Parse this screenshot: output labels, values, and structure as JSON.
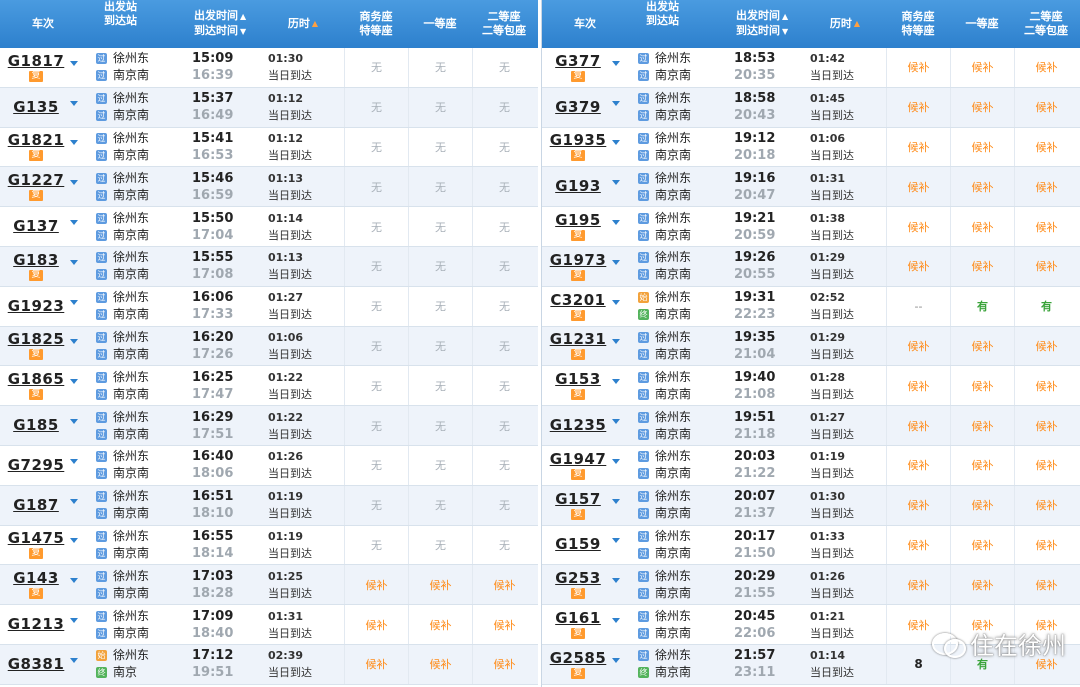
{
  "header": {
    "train": "车次",
    "dep_station": "出发站",
    "arr_station": "到达站",
    "dep_time": "出发时间",
    "arr_time": "到达时间",
    "duration": "历时",
    "business_1": "商务座",
    "business_2": "特等座",
    "first": "一等座",
    "second_1": "二等座",
    "second_2": "二等包座",
    "arrow_up": "▲",
    "arrow_down": "▼"
  },
  "badge_fu": "复",
  "watermark": "住在徐州",
  "left_rows": [
    {
      "train": "G1817",
      "fu": true,
      "from": "徐州东",
      "to": "南京南",
      "from_icon": "guo",
      "to_icon": "guo",
      "dep": "15:09",
      "arr": "16:39",
      "dur": "01:30",
      "day": "当日到达",
      "s1": "无",
      "s2": "无",
      "s3": "无"
    },
    {
      "train": "G135",
      "fu": false,
      "from": "徐州东",
      "to": "南京南",
      "from_icon": "guo",
      "to_icon": "guo",
      "dep": "15:37",
      "arr": "16:49",
      "dur": "01:12",
      "day": "当日到达",
      "s1": "无",
      "s2": "无",
      "s3": "无"
    },
    {
      "train": "G1821",
      "fu": true,
      "from": "徐州东",
      "to": "南京南",
      "from_icon": "guo",
      "to_icon": "guo",
      "dep": "15:41",
      "arr": "16:53",
      "dur": "01:12",
      "day": "当日到达",
      "s1": "无",
      "s2": "无",
      "s3": "无"
    },
    {
      "train": "G1227",
      "fu": true,
      "from": "徐州东",
      "to": "南京南",
      "from_icon": "guo",
      "to_icon": "guo",
      "dep": "15:46",
      "arr": "16:59",
      "dur": "01:13",
      "day": "当日到达",
      "s1": "无",
      "s2": "无",
      "s3": "无"
    },
    {
      "train": "G137",
      "fu": false,
      "from": "徐州东",
      "to": "南京南",
      "from_icon": "guo",
      "to_icon": "guo",
      "dep": "15:50",
      "arr": "17:04",
      "dur": "01:14",
      "day": "当日到达",
      "s1": "无",
      "s2": "无",
      "s3": "无"
    },
    {
      "train": "G183",
      "fu": true,
      "from": "徐州东",
      "to": "南京南",
      "from_icon": "guo",
      "to_icon": "guo",
      "dep": "15:55",
      "arr": "17:08",
      "dur": "01:13",
      "day": "当日到达",
      "s1": "无",
      "s2": "无",
      "s3": "无"
    },
    {
      "train": "G1923",
      "fu": false,
      "from": "徐州东",
      "to": "南京南",
      "from_icon": "guo",
      "to_icon": "guo",
      "dep": "16:06",
      "arr": "17:33",
      "dur": "01:27",
      "day": "当日到达",
      "s1": "无",
      "s2": "无",
      "s3": "无"
    },
    {
      "train": "G1825",
      "fu": true,
      "from": "徐州东",
      "to": "南京南",
      "from_icon": "guo",
      "to_icon": "guo",
      "dep": "16:20",
      "arr": "17:26",
      "dur": "01:06",
      "day": "当日到达",
      "s1": "无",
      "s2": "无",
      "s3": "无"
    },
    {
      "train": "G1865",
      "fu": true,
      "from": "徐州东",
      "to": "南京南",
      "from_icon": "guo",
      "to_icon": "guo",
      "dep": "16:25",
      "arr": "17:47",
      "dur": "01:22",
      "day": "当日到达",
      "s1": "无",
      "s2": "无",
      "s3": "无"
    },
    {
      "train": "G185",
      "fu": false,
      "from": "徐州东",
      "to": "南京南",
      "from_icon": "guo",
      "to_icon": "guo",
      "dep": "16:29",
      "arr": "17:51",
      "dur": "01:22",
      "day": "当日到达",
      "s1": "无",
      "s2": "无",
      "s3": "无"
    },
    {
      "train": "G7295",
      "fu": false,
      "from": "徐州东",
      "to": "南京南",
      "from_icon": "guo",
      "to_icon": "guo",
      "dep": "16:40",
      "arr": "18:06",
      "dur": "01:26",
      "day": "当日到达",
      "s1": "无",
      "s2": "无",
      "s3": "无"
    },
    {
      "train": "G187",
      "fu": false,
      "from": "徐州东",
      "to": "南京南",
      "from_icon": "guo",
      "to_icon": "guo",
      "dep": "16:51",
      "arr": "18:10",
      "dur": "01:19",
      "day": "当日到达",
      "s1": "无",
      "s2": "无",
      "s3": "无"
    },
    {
      "train": "G1475",
      "fu": true,
      "from": "徐州东",
      "to": "南京南",
      "from_icon": "guo",
      "to_icon": "guo",
      "dep": "16:55",
      "arr": "18:14",
      "dur": "01:19",
      "day": "当日到达",
      "s1": "无",
      "s2": "无",
      "s3": "无"
    },
    {
      "train": "G143",
      "fu": true,
      "from": "徐州东",
      "to": "南京南",
      "from_icon": "guo",
      "to_icon": "guo",
      "dep": "17:03",
      "arr": "18:28",
      "dur": "01:25",
      "day": "当日到达",
      "s1": "候补",
      "s2": "候补",
      "s3": "候补"
    },
    {
      "train": "G1213",
      "fu": false,
      "from": "徐州东",
      "to": "南京南",
      "from_icon": "guo",
      "to_icon": "guo",
      "dep": "17:09",
      "arr": "18:40",
      "dur": "01:31",
      "day": "当日到达",
      "s1": "候补",
      "s2": "候补",
      "s3": "候补"
    },
    {
      "train": "G8381",
      "fu": false,
      "from": "徐州东",
      "to": "南京",
      "from_icon": "shi",
      "to_icon": "zhong",
      "dep": "17:12",
      "arr": "19:51",
      "dur": "02:39",
      "day": "当日到达",
      "s1": "候补",
      "s2": "候补",
      "s3": "候补"
    }
  ],
  "right_rows": [
    {
      "train": "G377",
      "fu": true,
      "from": "徐州东",
      "to": "南京南",
      "from_icon": "guo",
      "to_icon": "guo",
      "dep": "18:53",
      "arr": "20:35",
      "dur": "01:42",
      "day": "当日到达",
      "s1": "候补",
      "s2": "候补",
      "s3": "候补"
    },
    {
      "train": "G379",
      "fu": false,
      "from": "徐州东",
      "to": "南京南",
      "from_icon": "guo",
      "to_icon": "guo",
      "dep": "18:58",
      "arr": "20:43",
      "dur": "01:45",
      "day": "当日到达",
      "s1": "候补",
      "s2": "候补",
      "s3": "候补"
    },
    {
      "train": "G1935",
      "fu": true,
      "from": "徐州东",
      "to": "南京南",
      "from_icon": "guo",
      "to_icon": "guo",
      "dep": "19:12",
      "arr": "20:18",
      "dur": "01:06",
      "day": "当日到达",
      "s1": "候补",
      "s2": "候补",
      "s3": "候补"
    },
    {
      "train": "G193",
      "fu": false,
      "from": "徐州东",
      "to": "南京南",
      "from_icon": "guo",
      "to_icon": "guo",
      "dep": "19:16",
      "arr": "20:47",
      "dur": "01:31",
      "day": "当日到达",
      "s1": "候补",
      "s2": "候补",
      "s3": "候补"
    },
    {
      "train": "G195",
      "fu": true,
      "from": "徐州东",
      "to": "南京南",
      "from_icon": "guo",
      "to_icon": "guo",
      "dep": "19:21",
      "arr": "20:59",
      "dur": "01:38",
      "day": "当日到达",
      "s1": "候补",
      "s2": "候补",
      "s3": "候补"
    },
    {
      "train": "G1973",
      "fu": true,
      "from": "徐州东",
      "to": "南京南",
      "from_icon": "guo",
      "to_icon": "guo",
      "dep": "19:26",
      "arr": "20:55",
      "dur": "01:29",
      "day": "当日到达",
      "s1": "候补",
      "s2": "候补",
      "s3": "候补"
    },
    {
      "train": "C3201",
      "fu": true,
      "from": "徐州东",
      "to": "南京南",
      "from_icon": "shi",
      "to_icon": "zhong",
      "dep": "19:31",
      "arr": "22:23",
      "dur": "02:52",
      "day": "当日到达",
      "s1": "--",
      "s2": "有",
      "s3": "有"
    },
    {
      "train": "G1231",
      "fu": true,
      "from": "徐州东",
      "to": "南京南",
      "from_icon": "guo",
      "to_icon": "guo",
      "dep": "19:35",
      "arr": "21:04",
      "dur": "01:29",
      "day": "当日到达",
      "s1": "候补",
      "s2": "候补",
      "s3": "候补"
    },
    {
      "train": "G153",
      "fu": true,
      "from": "徐州东",
      "to": "南京南",
      "from_icon": "guo",
      "to_icon": "guo",
      "dep": "19:40",
      "arr": "21:08",
      "dur": "01:28",
      "day": "当日到达",
      "s1": "候补",
      "s2": "候补",
      "s3": "候补"
    },
    {
      "train": "G1235",
      "fu": false,
      "from": "徐州东",
      "to": "南京南",
      "from_icon": "guo",
      "to_icon": "guo",
      "dep": "19:51",
      "arr": "21:18",
      "dur": "01:27",
      "day": "当日到达",
      "s1": "候补",
      "s2": "候补",
      "s3": "候补"
    },
    {
      "train": "G1947",
      "fu": true,
      "from": "徐州东",
      "to": "南京南",
      "from_icon": "guo",
      "to_icon": "guo",
      "dep": "20:03",
      "arr": "21:22",
      "dur": "01:19",
      "day": "当日到达",
      "s1": "候补",
      "s2": "候补",
      "s3": "候补"
    },
    {
      "train": "G157",
      "fu": true,
      "from": "徐州东",
      "to": "南京南",
      "from_icon": "guo",
      "to_icon": "guo",
      "dep": "20:07",
      "arr": "21:37",
      "dur": "01:30",
      "day": "当日到达",
      "s1": "候补",
      "s2": "候补",
      "s3": "候补"
    },
    {
      "train": "G159",
      "fu": false,
      "from": "徐州东",
      "to": "南京南",
      "from_icon": "guo",
      "to_icon": "guo",
      "dep": "20:17",
      "arr": "21:50",
      "dur": "01:33",
      "day": "当日到达",
      "s1": "候补",
      "s2": "候补",
      "s3": "候补"
    },
    {
      "train": "G253",
      "fu": true,
      "from": "徐州东",
      "to": "南京南",
      "from_icon": "guo",
      "to_icon": "guo",
      "dep": "20:29",
      "arr": "21:55",
      "dur": "01:26",
      "day": "当日到达",
      "s1": "候补",
      "s2": "候补",
      "s3": "候补"
    },
    {
      "train": "G161",
      "fu": true,
      "from": "徐州东",
      "to": "南京南",
      "from_icon": "guo",
      "to_icon": "guo",
      "dep": "20:45",
      "arr": "22:06",
      "dur": "01:21",
      "day": "当日到达",
      "s1": "候补",
      "s2": "候补",
      "s3": "候补"
    },
    {
      "train": "G2585",
      "fu": true,
      "from": "徐州东",
      "to": "南京南",
      "from_icon": "guo",
      "to_icon": "zhong",
      "dep": "21:57",
      "arr": "23:11",
      "dur": "01:14",
      "day": "当日到达",
      "s1": "8",
      "s2": "有",
      "s3": "候补"
    }
  ],
  "icons": {
    "guo": "过",
    "shi": "始",
    "zhong": "终"
  },
  "colors": {
    "header": "#2d80cd",
    "hb": "#ff8c1a",
    "you": "#3aa33a",
    "fu_badge": "#ff9a2e"
  }
}
